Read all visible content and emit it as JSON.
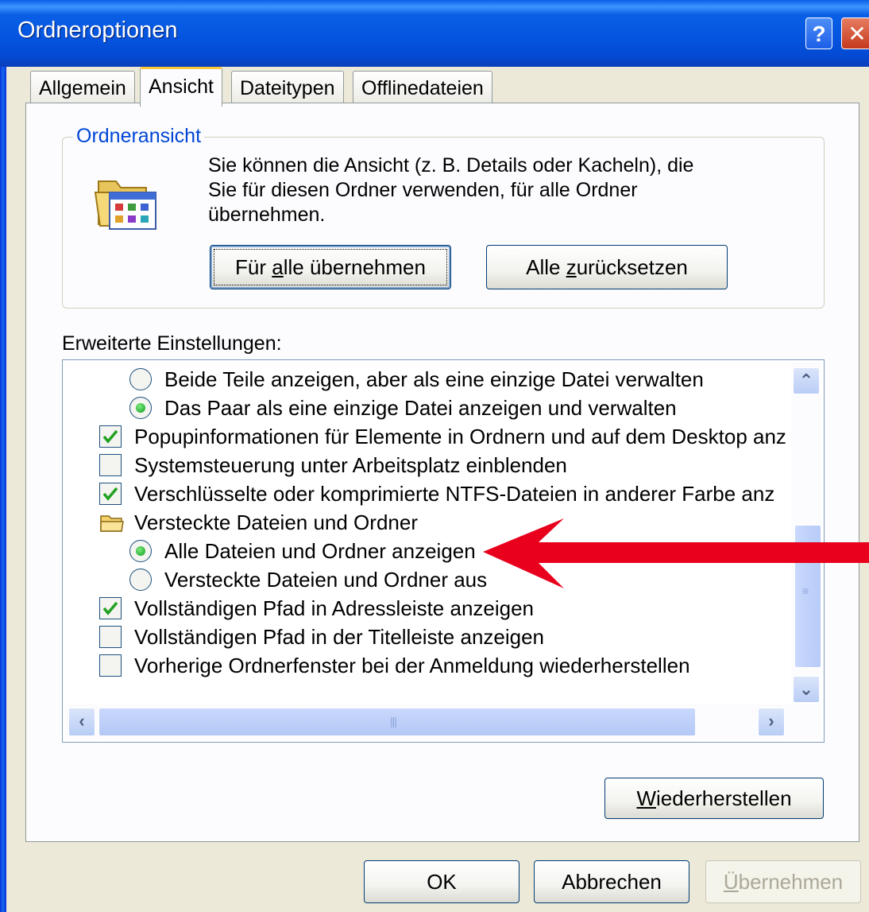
{
  "window": {
    "title": "Ordneroptionen",
    "help_glyph": "?",
    "close_glyph": "✕"
  },
  "tabs": [
    {
      "label": "Allgemein",
      "active": false
    },
    {
      "label": "Ansicht",
      "active": true
    },
    {
      "label": "Dateitypen",
      "active": false
    },
    {
      "label": "Offlinedateien",
      "active": false
    }
  ],
  "folder_view": {
    "label": "Ordneransicht",
    "description": [
      "Sie können die Ansicht (z. B. Details oder Kacheln), die",
      "Sie für diesen Ordner verwenden, für alle Ordner",
      "übernehmen."
    ],
    "apply_all_button": {
      "pre": "Für ",
      "accel": "a",
      "post": "lle übernehmen"
    },
    "reset_all_button": {
      "pre": "Alle ",
      "accel": "z",
      "post": "urücksetzen"
    }
  },
  "advanced": {
    "label": "Erweiterte Einstellungen:",
    "items": [
      {
        "type": "radio",
        "checked": false,
        "text": "Beide Teile anzeigen, aber als eine einzige Datei verwalten"
      },
      {
        "type": "radio",
        "checked": true,
        "text": "Das Paar als eine einzige Datei anzeigen und verwalten"
      },
      {
        "type": "checkbox",
        "checked": true,
        "text": "Popupinformationen für Elemente in Ordnern und auf dem Desktop anz"
      },
      {
        "type": "checkbox",
        "checked": false,
        "text": "Systemsteuerung unter Arbeitsplatz einblenden"
      },
      {
        "type": "checkbox",
        "checked": true,
        "text": "Verschlüsselte oder komprimierte NTFS-Dateien in anderer Farbe anz"
      },
      {
        "type": "folder",
        "text": "Versteckte Dateien und Ordner"
      },
      {
        "type": "radio",
        "checked": true,
        "text": "Alle Dateien und Ordner anzeigen"
      },
      {
        "type": "radio",
        "checked": false,
        "text": "Versteckte Dateien und Ordner aus"
      },
      {
        "type": "checkbox",
        "checked": true,
        "text": "Vollständigen Pfad in Adressleiste anzeigen"
      },
      {
        "type": "checkbox",
        "checked": false,
        "text": "Vollständigen Pfad in der Titelleiste anzeigen"
      },
      {
        "type": "checkbox",
        "checked": false,
        "text": "Vorherige Ordnerfenster bei der Anmeldung wiederherstellen"
      }
    ],
    "restore_button": {
      "pre": "",
      "accel": "W",
      "post": "iederherstellen"
    }
  },
  "footer": {
    "ok": "OK",
    "cancel": "Abbrechen",
    "apply": {
      "pre": "",
      "accel": "Ü",
      "post": "bernehmen"
    }
  },
  "colors": {
    "title_bar": "#0a5fe6",
    "group_label": "#0046d5",
    "active_tab_accent": "#ffc83c",
    "arrow": "#e8001c",
    "radio_dot": "#0b9d1f",
    "check_mark": "#21a121"
  }
}
